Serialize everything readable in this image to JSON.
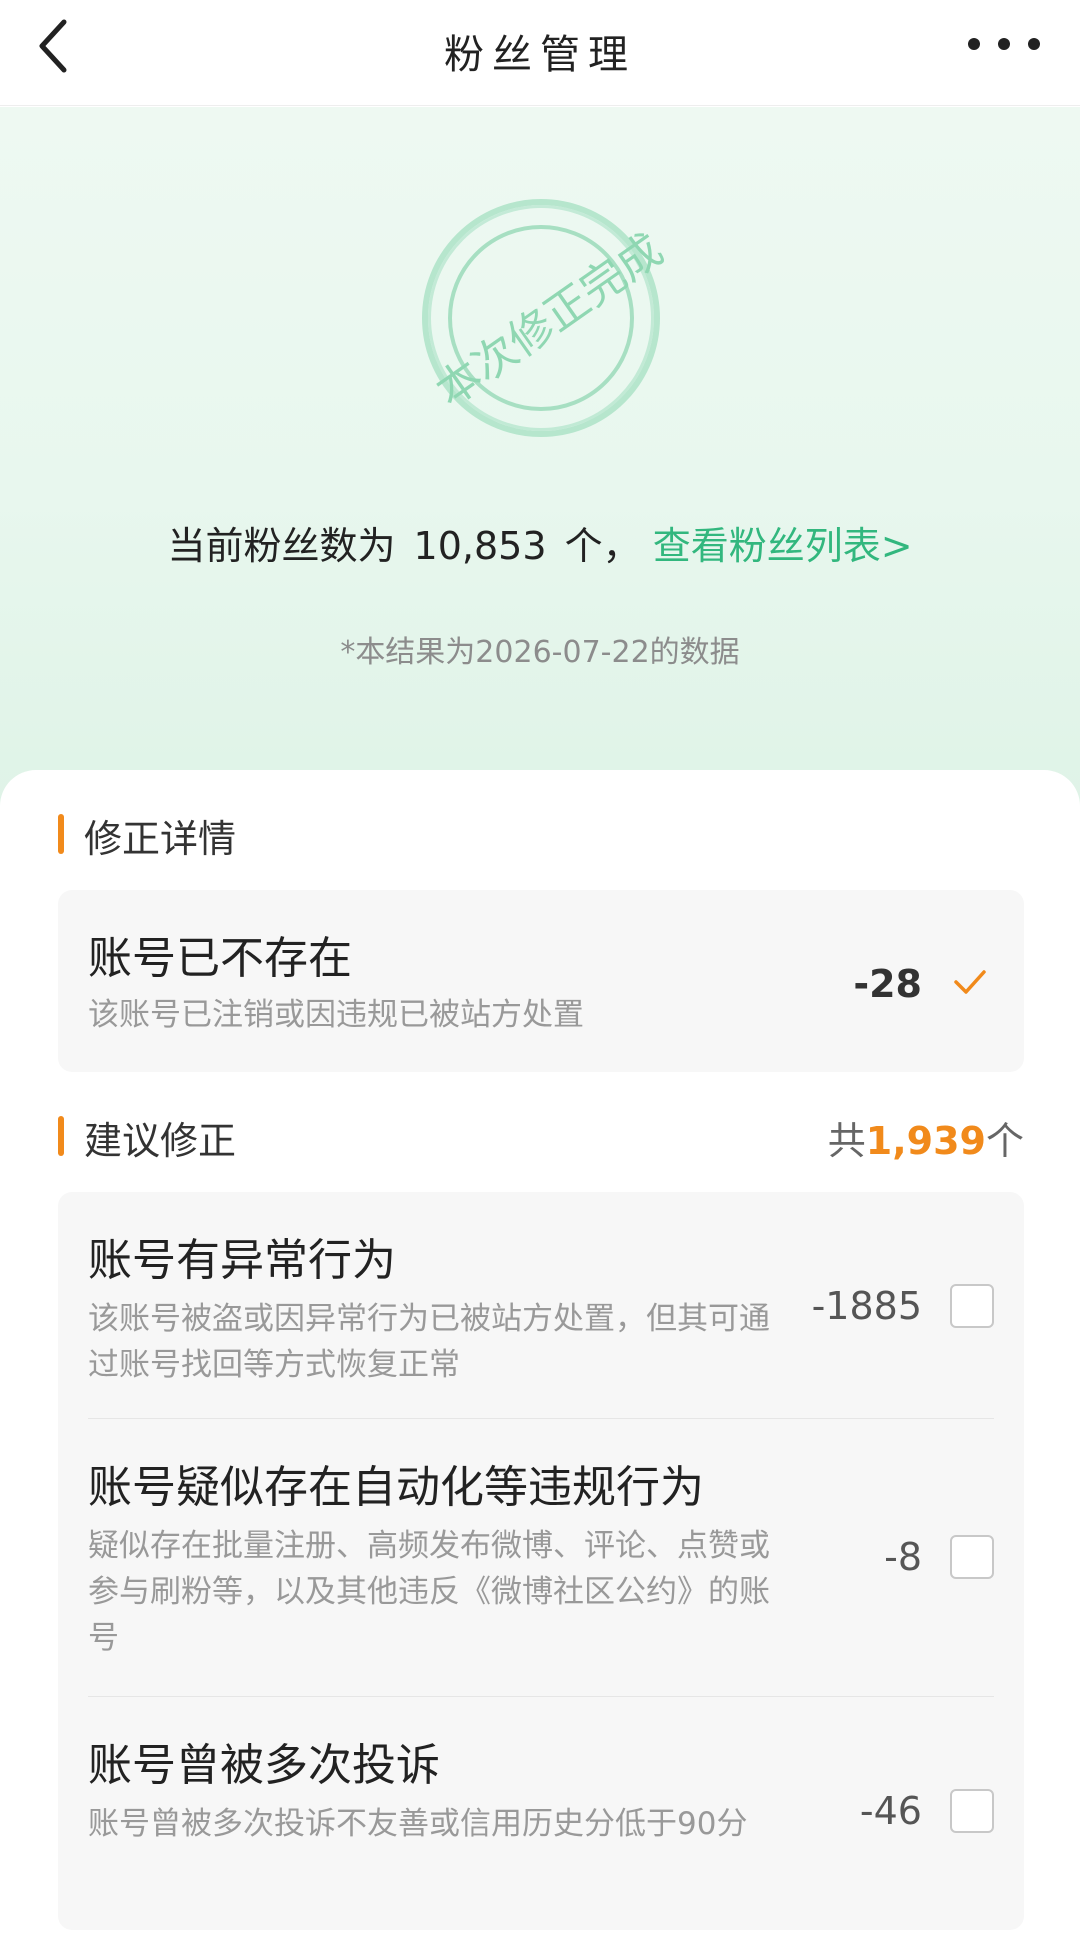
{
  "navbar": {
    "title": "粉丝管理",
    "back_icon": "chevron-left-icon",
    "more_icon": "more-horizontal-icon"
  },
  "hero": {
    "stamp_text": "本次修正完成",
    "fans_prefix": "当前粉丝数为",
    "fans_count": "10,853",
    "fans_suffix": "个，",
    "fans_link": "查看粉丝列表>",
    "data_note": "*本结果为2026-07-22的数据"
  },
  "details": {
    "title": "修正详情",
    "items": [
      {
        "title": "账号已不存在",
        "desc": "该账号已注销或因违规已被站方处置",
        "value": "-28",
        "checked": true
      }
    ]
  },
  "suggest": {
    "title": "建议修正",
    "total_prefix": "共",
    "total_num": "1,939",
    "total_suffix": "个",
    "items": [
      {
        "title": "账号有异常行为",
        "desc": "该账号被盗或因异常行为已被站方处置，但其可通过账号找回等方式恢复正常",
        "value": "-1885",
        "checked": false
      },
      {
        "title": "账号疑似存在自动化等违规行为",
        "desc": "疑似存在批量注册、高频发布微博、评论、点赞或参与刷粉等，以及其他违反《微博社区公约》的账号",
        "value": "-8",
        "checked": false
      },
      {
        "title": "账号曾被多次投诉",
        "desc": "账号曾被多次投诉不友善或信用历史分低于90分",
        "value": "-46",
        "checked": false
      }
    ]
  },
  "colors": {
    "accent_orange": "#f18a1b",
    "link_green": "#32b77e",
    "hero_bg": "#e8f7ee"
  }
}
